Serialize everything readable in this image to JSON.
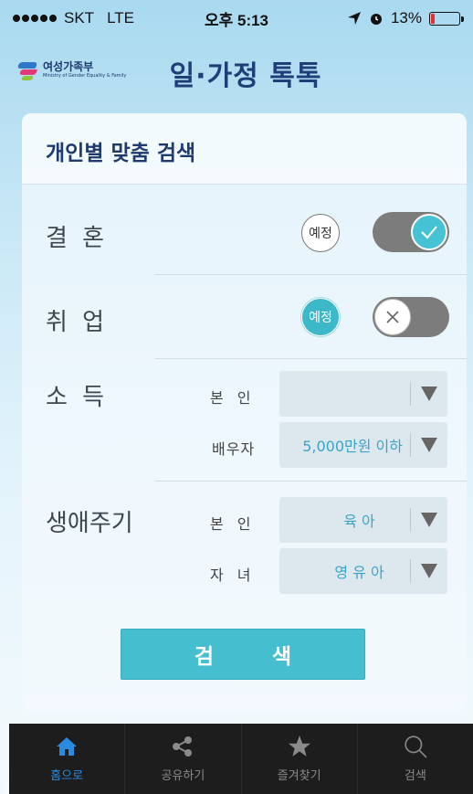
{
  "status_bar": {
    "carrier": "SKT",
    "network": "LTE",
    "time": "오후 5:13",
    "battery": "13%",
    "battery_level": 0.13
  },
  "header": {
    "logo_name": "여성가족부",
    "logo_subtitle": "Ministry of Gender Equality & Family",
    "title": "일·가정 톡톡"
  },
  "card": {
    "title": "개인별 맞춤 검색",
    "marriage": {
      "label": "결 혼",
      "tag": "예정",
      "tag_selected": false,
      "toggle_on": true
    },
    "employment": {
      "label": "취 업",
      "tag": "예정",
      "tag_selected": true,
      "toggle_on": false
    },
    "income": {
      "label": "소 득",
      "self_label": "본 인",
      "self_value": "",
      "spouse_label": "배우자",
      "spouse_value": "5,000만원 이하"
    },
    "lifecycle": {
      "label": "생애주기",
      "self_label": "본 인",
      "self_value": "육 아",
      "child_label": "자 녀",
      "child_value": "영 유 아"
    },
    "search_button": "검 색"
  },
  "tab_bar": {
    "tabs": [
      {
        "label": "홈으로",
        "icon": "home-icon",
        "active": true
      },
      {
        "label": "공유하기",
        "icon": "share-icon",
        "active": false
      },
      {
        "label": "즐겨찾기",
        "icon": "star-icon",
        "active": false
      },
      {
        "label": "검색",
        "icon": "search-icon",
        "active": false
      }
    ]
  },
  "colors": {
    "accent": "#45bfcf",
    "title_navy": "#1e3f78",
    "tab_active": "#2a8be0"
  }
}
